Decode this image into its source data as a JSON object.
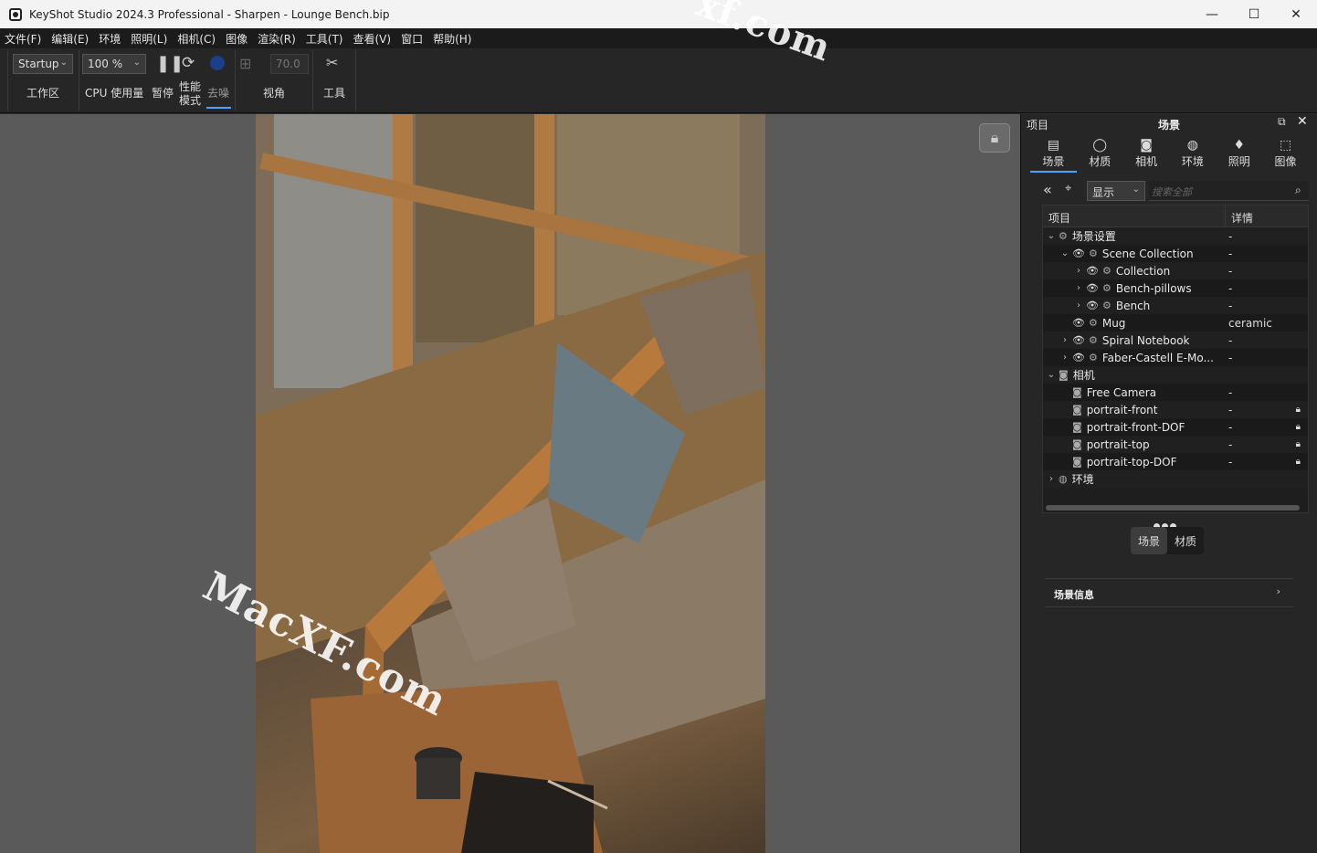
{
  "window": {
    "title": "KeyShot Studio 2024.3 Professional  - Sharpen - Lounge Bench.bip",
    "controls": {
      "minimize": "—",
      "maximize": "☐",
      "close": "✕"
    }
  },
  "menu": [
    "文件(F)",
    "编辑(E)",
    "环境",
    "照明(L)",
    "相机(C)",
    "图像",
    "渲染(R)",
    "工具(T)",
    "查看(V)",
    "窗口",
    "帮助(H)"
  ],
  "toolbar": {
    "workspace_value": "Startup",
    "workspace_label": "工作区",
    "cpu_value": "100 %",
    "cpu_label": "CPU 使用量",
    "pause_label": "暂停",
    "perf_label_1": "性能",
    "perf_label_2": "模式",
    "denoise_label": "去噪",
    "fov_value": "70.0",
    "view_label": "视角",
    "tools_label": "工具"
  },
  "viewport": {
    "watermark_main": "MacXF.com",
    "watermark_top": "xf.com"
  },
  "panel": {
    "left_title": "项目",
    "center_title": "场景",
    "tabs": [
      {
        "label": "场景",
        "icon": "scene-icon",
        "glyph": "▤"
      },
      {
        "label": "材质",
        "icon": "material-icon",
        "glyph": "◯"
      },
      {
        "label": "相机",
        "icon": "camera-icon",
        "glyph": "◙"
      },
      {
        "label": "环境",
        "icon": "environment-icon",
        "glyph": "◍"
      },
      {
        "label": "照明",
        "icon": "lighting-icon",
        "glyph": "♦"
      },
      {
        "label": "图像",
        "icon": "image-icon",
        "glyph": "⬚"
      }
    ],
    "filter_value": "显示",
    "search_placeholder": "搜索全部",
    "tree_headers": {
      "item": "项目",
      "detail": "详情"
    },
    "tree": [
      {
        "indent": 0,
        "toggle": "⌄",
        "eye": false,
        "label": "场景设置",
        "detail": "-",
        "locked": false,
        "icon": "⚙"
      },
      {
        "indent": 1,
        "toggle": "⌄",
        "eye": true,
        "label": "Scene Collection",
        "detail": "-",
        "locked": false,
        "icon": "⚙"
      },
      {
        "indent": 2,
        "toggle": "›",
        "eye": true,
        "label": "Collection",
        "detail": "-",
        "locked": false,
        "icon": "⚙"
      },
      {
        "indent": 2,
        "toggle": "›",
        "eye": true,
        "label": "Bench-pillows",
        "detail": "-",
        "locked": false,
        "icon": "⚙"
      },
      {
        "indent": 2,
        "toggle": "›",
        "eye": true,
        "label": "Bench",
        "detail": "-",
        "locked": false,
        "icon": "⚙"
      },
      {
        "indent": 1,
        "toggle": "",
        "eye": true,
        "label": "Mug",
        "detail": "ceramic",
        "locked": false,
        "icon": "⚙"
      },
      {
        "indent": 1,
        "toggle": "›",
        "eye": true,
        "label": "Spiral Notebook",
        "detail": "-",
        "locked": false,
        "icon": "⚙"
      },
      {
        "indent": 1,
        "toggle": "›",
        "eye": true,
        "label": "Faber-Castell E-Mo...",
        "detail": "-",
        "locked": false,
        "icon": "⚙"
      },
      {
        "indent": 0,
        "toggle": "⌄",
        "eye": false,
        "label": "相机",
        "detail": "",
        "locked": false,
        "icon": "◙"
      },
      {
        "indent": 1,
        "toggle": "",
        "eye": false,
        "label": "Free Camera",
        "detail": "-",
        "locked": false,
        "icon": "◙"
      },
      {
        "indent": 1,
        "toggle": "",
        "eye": false,
        "label": "portrait-front",
        "detail": "-",
        "locked": true,
        "icon": "◙"
      },
      {
        "indent": 1,
        "toggle": "",
        "eye": false,
        "label": "portrait-front-DOF",
        "detail": "-",
        "locked": true,
        "icon": "◙"
      },
      {
        "indent": 1,
        "toggle": "",
        "eye": false,
        "label": "portrait-top",
        "detail": "-",
        "locked": true,
        "icon": "◙"
      },
      {
        "indent": 1,
        "toggle": "",
        "eye": false,
        "label": "portrait-top-DOF",
        "detail": "-",
        "locked": true,
        "icon": "◙"
      },
      {
        "indent": 0,
        "toggle": "›",
        "eye": false,
        "label": "环境",
        "detail": "",
        "locked": false,
        "icon": "◍"
      }
    ],
    "segment": [
      "场景",
      "材质"
    ],
    "scene_info": "场景信息"
  }
}
